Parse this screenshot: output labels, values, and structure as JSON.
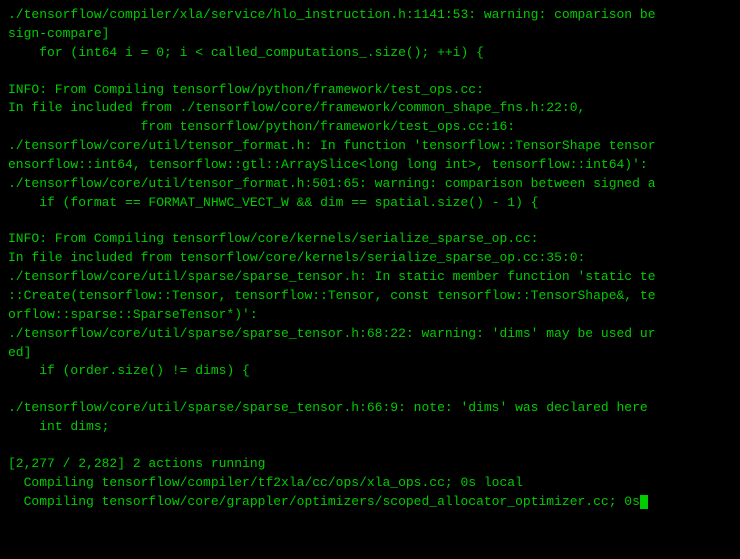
{
  "terminal": {
    "lines": [
      "./tensorflow/compiler/xla/service/hlo_instruction.h:1141:53: warning: comparison be",
      "sign-compare]",
      "    for (int64 i = 0; i < called_computations_.size(); ++i) {",
      "",
      "INFO: From Compiling tensorflow/python/framework/test_ops.cc:",
      "In file included from ./tensorflow/core/framework/common_shape_fns.h:22:0,",
      "                 from tensorflow/python/framework/test_ops.cc:16:",
      "./tensorflow/core/util/tensor_format.h: In function 'tensorflow::TensorShape tensor",
      "ensorflow::int64, tensorflow::gtl::ArraySlice<long long int>, tensorflow::int64)':",
      "./tensorflow/core/util/tensor_format.h:501:65: warning: comparison between signed a",
      "    if (format == FORMAT_NHWC_VECT_W && dim == spatial.size() - 1) {",
      "",
      "INFO: From Compiling tensorflow/core/kernels/serialize_sparse_op.cc:",
      "In file included from tensorflow/core/kernels/serialize_sparse_op.cc:35:0:",
      "./tensorflow/core/util/sparse/sparse_tensor.h: In static member function 'static te",
      "::Create(tensorflow::Tensor, tensorflow::Tensor, const tensorflow::TensorShape&, te",
      "orflow::sparse::SparseTensor*)':",
      "./tensorflow/core/util/sparse/sparse_tensor.h:68:22: warning: 'dims' may be used ur",
      "ed]",
      "    if (order.size() != dims) {",
      "",
      "./tensorflow/core/util/sparse/sparse_tensor.h:66:9: note: 'dims' was declared here",
      "    int dims;",
      "",
      "[2,277 / 2,282] 2 actions running",
      "  Compiling tensorflow/compiler/tf2xla/cc/ops/xla_ops.cc; 0s local",
      "  Compiling tensorflow/core/grappler/optimizers/scoped_allocator_optimizer.cc; 0s"
    ],
    "cursor_visible": true
  }
}
